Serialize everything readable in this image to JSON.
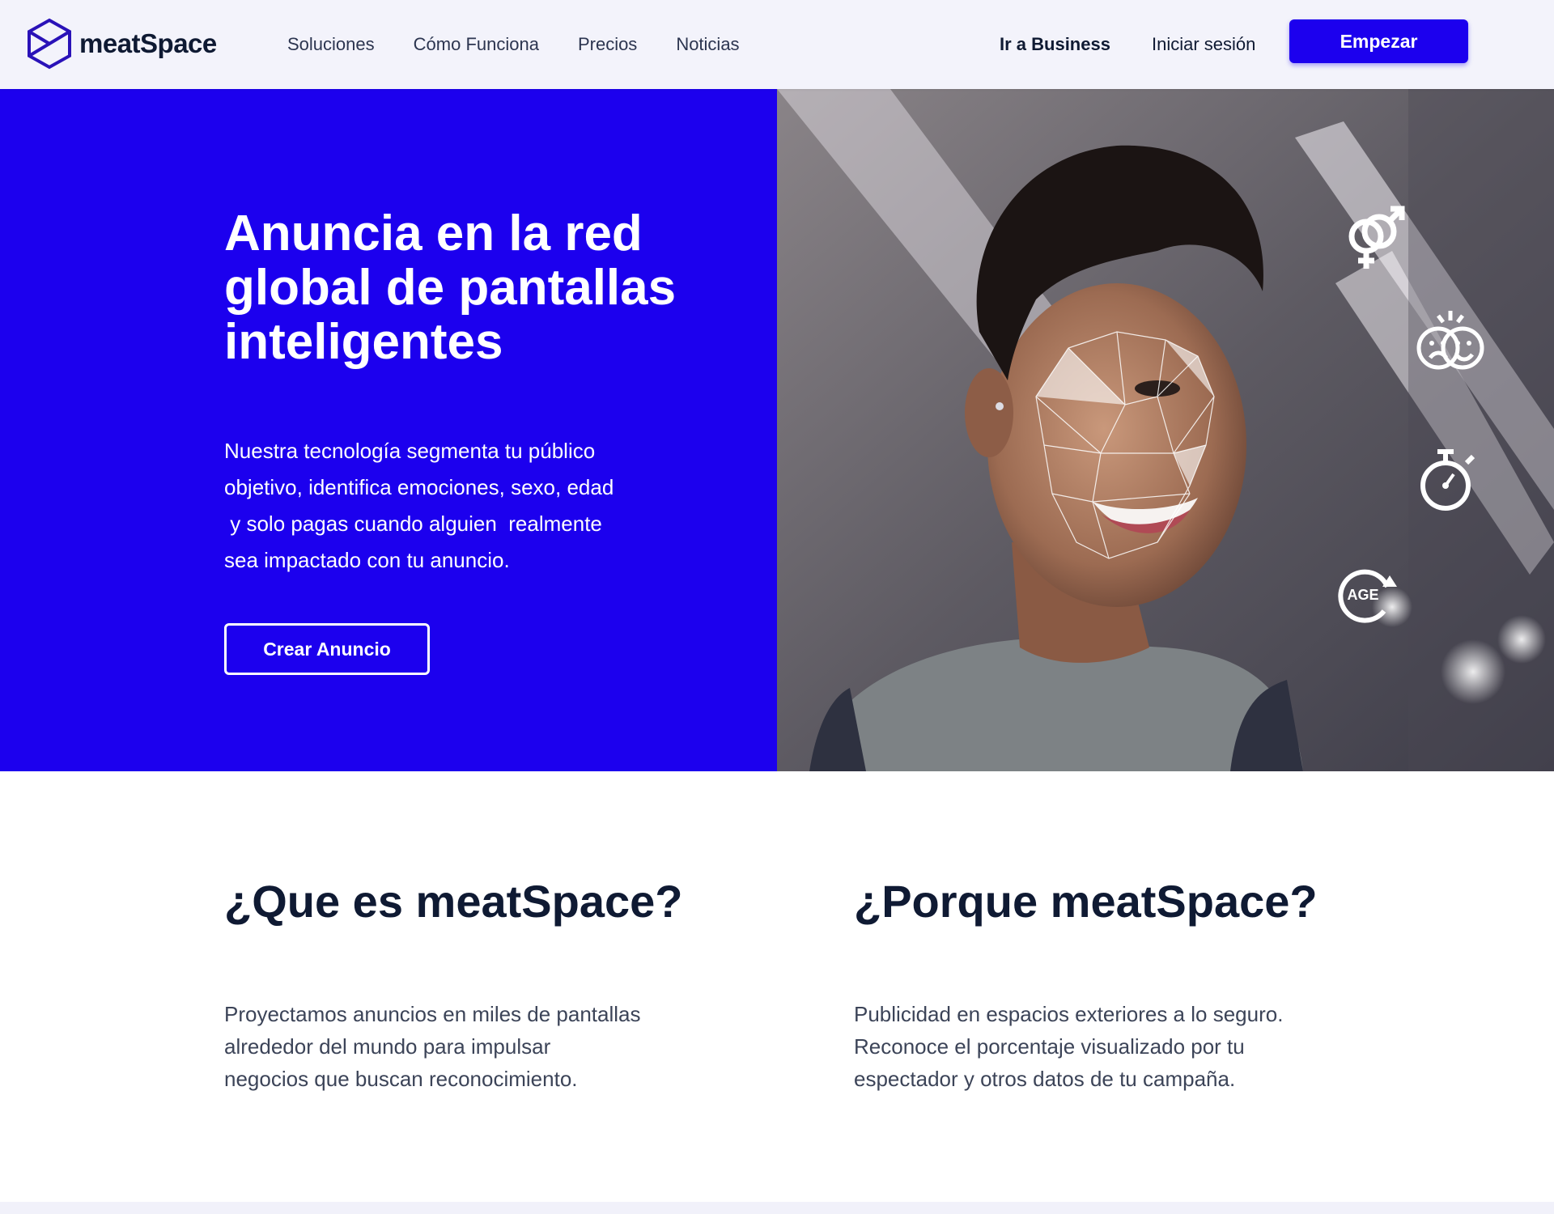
{
  "brand": {
    "name": "meatSpace",
    "primary": "#1c00ee",
    "dark": "#0f1a33"
  },
  "nav": {
    "links": [
      "Soluciones",
      "Cómo Funciona",
      "Precios",
      "Noticias"
    ],
    "business_label": "Ir a Business",
    "login_label": "Iniciar sesión",
    "start_label": "Empezar"
  },
  "hero": {
    "title": "Anuncia en la red global de pantallas inteligentes",
    "description": "Nuestra tecnología segmenta tu público\nobjetivo, identifica emociones, sexo, edad\n y solo pagas cuando alguien  realmente\nsea impactado con tu anuncio.",
    "cta_label": "Crear Anuncio",
    "feature_icons": [
      "gender-icon",
      "emotion-masks-icon",
      "stopwatch-icon",
      "age-icon"
    ],
    "age_badge": "AGE"
  },
  "info": {
    "what": {
      "title": "¿Que es meatSpace?",
      "text": "Proyectamos anuncios en miles de pantallas\nalrededor del mundo para impulsar\nnegocios que buscan reconocimiento."
    },
    "why": {
      "title": "¿Porque meatSpace?",
      "text": "Publicidad en espacios exteriores a lo seguro.\nReconoce el porcentaje visualizado por tu\nespectador y otros datos de tu campaña."
    }
  }
}
